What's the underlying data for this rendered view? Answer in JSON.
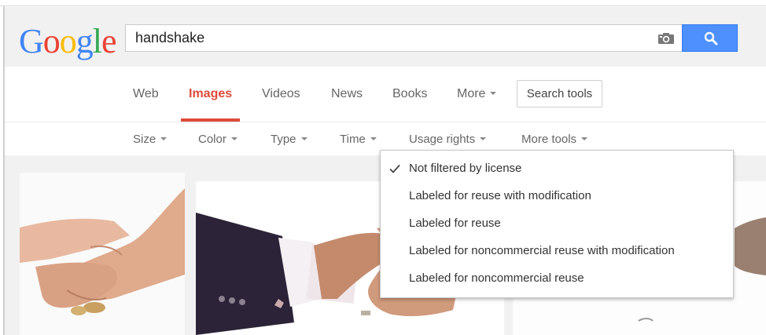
{
  "logo": {
    "letters": [
      "G",
      "o",
      "o",
      "g",
      "l",
      "e"
    ],
    "colors": [
      "#4285f4",
      "#ea4335",
      "#fbbc05",
      "#4285f4",
      "#34a853",
      "#ea4335"
    ]
  },
  "search": {
    "query": "handshake",
    "camera_icon": "camera-icon",
    "search_icon": "magnifier-icon",
    "button_color": "#4d90fe"
  },
  "nav": {
    "items": [
      {
        "label": "Web"
      },
      {
        "label": "Images"
      },
      {
        "label": "Videos"
      },
      {
        "label": "News"
      },
      {
        "label": "Books"
      },
      {
        "label": "More"
      }
    ],
    "active_color": "#dd4b39",
    "search_tools": "Search tools"
  },
  "tools": {
    "items": [
      {
        "label": "Size"
      },
      {
        "label": "Color"
      },
      {
        "label": "Type"
      },
      {
        "label": "Time"
      },
      {
        "label": "Usage rights"
      },
      {
        "label": "More tools"
      }
    ]
  },
  "usage_rights_menu": {
    "items": [
      {
        "label": "Not filtered by license",
        "checked": true
      },
      {
        "label": "Labeled for reuse with modification",
        "checked": false
      },
      {
        "label": "Labeled for reuse",
        "checked": false
      },
      {
        "label": "Labeled for noncommercial reuse with modification",
        "checked": false
      },
      {
        "label": "Labeled for noncommercial reuse",
        "checked": false
      }
    ]
  }
}
